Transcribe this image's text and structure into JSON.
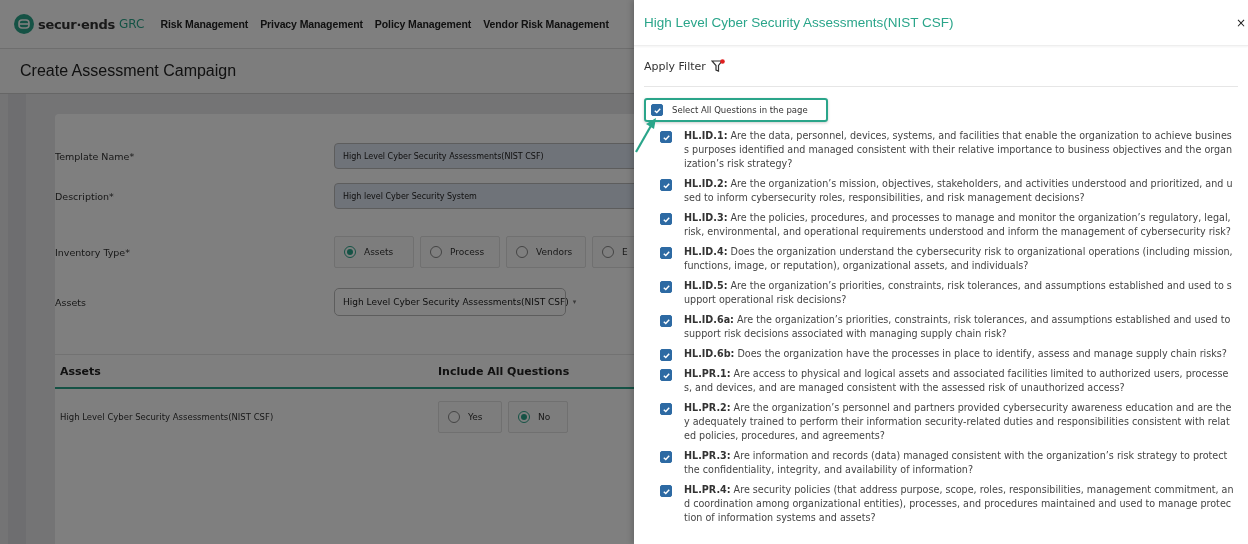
{
  "nav": {
    "brand": "secur·ends",
    "brand_suffix": "GRC",
    "items": [
      "Risk Management",
      "Privacy Management",
      "Policy Management",
      "Vendor Risk Management"
    ]
  },
  "page_title": "Create Assessment Campaign",
  "form": {
    "template_name": {
      "label": "Template Name*",
      "value": "High Level Cyber Security Assessments(NIST CSF)"
    },
    "description": {
      "label": "Description*",
      "value": "High level Cyber Security System"
    },
    "inventory_type": {
      "label": "Inventory Type*",
      "options": [
        {
          "label": "Assets",
          "selected": true
        },
        {
          "label": "Process",
          "selected": false
        },
        {
          "label": "Vendors",
          "selected": false
        },
        {
          "label": "E",
          "selected": false
        }
      ]
    },
    "assets": {
      "label": "Assets",
      "value": "High Level Cyber Security Assessments(NIST CSF)",
      "caret": "▾"
    }
  },
  "assets_table": {
    "columns": [
      "Assets",
      "Include All Questions"
    ],
    "rows": [
      {
        "name": "High Level Cyber Security Assessments(NIST CSF)",
        "options": [
          {
            "label": "Yes",
            "selected": false
          },
          {
            "label": "No",
            "selected": true
          }
        ]
      }
    ]
  },
  "drawer": {
    "title": "High Level Cyber Security Assessments(NIST CSF)",
    "close": "×",
    "filter_label": "Apply Filter",
    "select_all": {
      "label": "Select All Questions in the page",
      "checked": true
    },
    "questions": [
      {
        "code": "HL.ID.1:",
        "text": "Are the data, personnel, devices, systems, and facilities that enable the organization to achieve business purposes identified and managed consistent with their relative importance to business objectives and the organization’s risk strategy?",
        "checked": true
      },
      {
        "code": "HL.ID.2:",
        "text": "Are the organization’s mission, objectives, stakeholders, and activities understood and prioritized, and used to inform cybersecurity roles, responsibilities, and risk management decisions?",
        "checked": true
      },
      {
        "code": "HL.ID.3:",
        "text": "Are the policies, procedures, and processes to manage and monitor the organization’s regulatory, legal, risk, environmental, and operational requirements understood and inform the management of cybersecurity risk?",
        "checked": true
      },
      {
        "code": "HL.ID.4:",
        "text": "Does the organization understand the cybersecurity risk to organizational operations (including mission, functions, image, or reputation), organizational assets, and individuals?",
        "checked": true
      },
      {
        "code": "HL.ID.5:",
        "text": "Are the organization’s priorities, constraints, risk tolerances, and assumptions established and used to support operational risk decisions?",
        "checked": true
      },
      {
        "code": "HL.ID.6a:",
        "text": "Are the organization’s priorities, constraints, risk tolerances, and assumptions established and used to support risk decisions associated with managing supply chain risk?",
        "checked": true
      },
      {
        "code": "HL.ID.6b:",
        "text": "Does the organization have the processes in place to identify, assess and manage supply chain risks?",
        "checked": true
      },
      {
        "code": "HL.PR.1:",
        "text": "Are access to physical and logical assets and associated facilities limited to authorized users, processes, and devices, and are managed consistent with the assessed risk of unauthorized access?",
        "checked": true
      },
      {
        "code": "HL.PR.2:",
        "text": "Are the organization’s personnel and partners provided cybersecurity awareness education and are they adequately trained to perform their information security-related duties and responsibilities consistent with related policies, procedures, and agreements?",
        "checked": true
      },
      {
        "code": "HL.PR.3:",
        "text": "Are information and records (data) managed consistent with the organization’s risk strategy to protect the confidentiality, integrity, and availability of information?",
        "checked": true
      },
      {
        "code": "HL.PR.4:",
        "text": "Are security policies (that address purpose, scope, roles, responsibilities, management commitment, and coordination among organizational entities), processes, and procedures maintained and used to manage protection of information systems and assets?",
        "checked": true
      }
    ]
  }
}
